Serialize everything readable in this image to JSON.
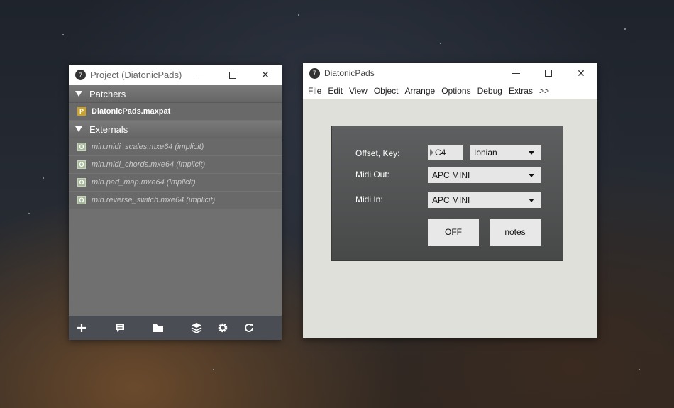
{
  "project_window": {
    "title": "Project (DiatonicPads)",
    "sections": [
      {
        "label": "Patchers",
        "items": [
          {
            "badge": "P",
            "name": "DiatonicPads.maxpat"
          }
        ]
      },
      {
        "label": "Externals",
        "items": [
          {
            "badge": "O",
            "name": "min.midi_scales.mxe64 (implicit)"
          },
          {
            "badge": "O",
            "name": "min.midi_chords.mxe64 (implicit)"
          },
          {
            "badge": "O",
            "name": "min.pad_map.mxe64 (implicit)"
          },
          {
            "badge": "O",
            "name": "min.reverse_switch.mxe64 (implicit)"
          }
        ]
      }
    ],
    "footer_icons": [
      "add-icon",
      "comment-icon",
      "folder-icon",
      "layers-icon",
      "gear-icon",
      "refresh-icon"
    ]
  },
  "diatonic_window": {
    "title": "DiatonicPads",
    "menu": [
      "File",
      "Edit",
      "View",
      "Object",
      "Arrange",
      "Options",
      "Debug",
      "Extras",
      ">>"
    ],
    "panel": {
      "offset_label": "Offset, Key:",
      "offset_value": "C4",
      "key_value": "Ionian",
      "midi_out_label": "Midi Out:",
      "midi_out_value": "APC MINI",
      "midi_in_label": "Midi In:",
      "midi_in_value": "APC MINI",
      "toggle_label": "OFF",
      "notes_label": "notes"
    }
  },
  "colors": {
    "badge_p": "#c9a227",
    "badge_o": "#a8b89a",
    "panel": "#555757"
  }
}
